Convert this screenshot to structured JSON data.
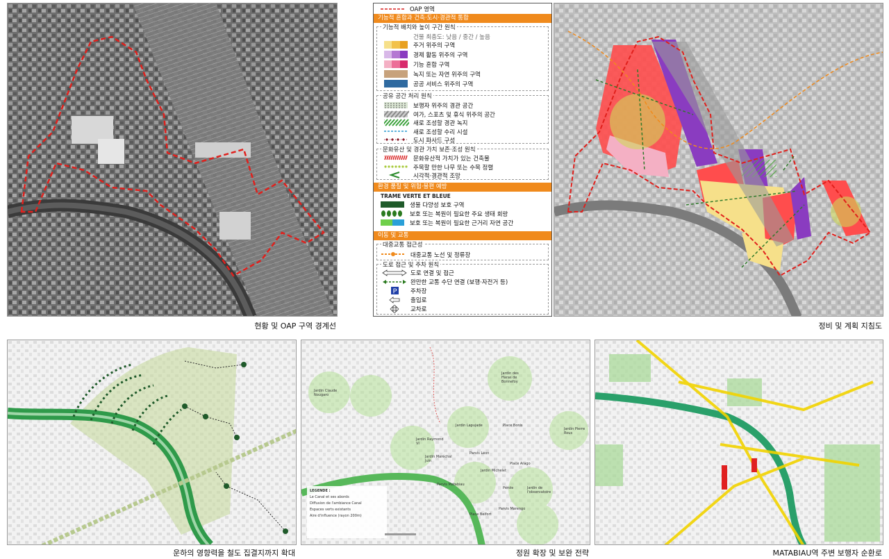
{
  "captions": {
    "top_left": "현황 및 OAP 구역 경계선",
    "top_right": "정비 및 계획 지침도",
    "bottom_left": "운하의 영향력을 철도 집결지까지 확대",
    "bottom_middle": "정원 확장 및 보완 전략",
    "bottom_right": "MATABIAU역 주변 보행자 순환로"
  },
  "legend": {
    "oap_label": "OAP 영역",
    "section1_bar": "기능적 혼합과 건축·도시·경관적 통합",
    "section1a_title": "기능적 배치와 높이 구간 원칙",
    "height_note": "건물 최층도: 낮음 / 중간 / 높음",
    "functions": [
      {
        "label": "주거 위주의 구역",
        "colors": [
          "#f6e08a",
          "#f2c24a",
          "#e8a020"
        ]
      },
      {
        "label": "경제 활동 위주의 구역",
        "colors": [
          "#d8b8e8",
          "#b478d2",
          "#8a3cc0"
        ]
      },
      {
        "label": "기능 혼합 구역",
        "colors": [
          "#f4b0c4",
          "#ec6e98",
          "#d82a6c"
        ]
      },
      {
        "label": "녹지 또는 자연 위주의 구역",
        "colors": [
          "#c7a27c",
          "#c7a27c",
          "#c7a27c"
        ]
      },
      {
        "label": "공공 서비스 위주의 구역",
        "colors": [
          "#2f6aa0",
          "#2f6aa0",
          "#2f6aa0"
        ]
      }
    ],
    "section1b_title": "공유 공간 처리 원칙",
    "shared": [
      {
        "label": "보행자 위주의 경관 공간",
        "style": "dots"
      },
      {
        "label": "여가, 스포츠 및 휴식 위주의 공간",
        "style": "hatch-grey"
      },
      {
        "label": "새로 조성할 경관 녹지",
        "style": "hatch-green"
      },
      {
        "label": "새로 조성할 수리 시설",
        "style": "dash-blue"
      },
      {
        "label": "도시 파사드 구성",
        "style": "diamond-red"
      }
    ],
    "section1c_title": "문화유산 및 경관 가치 보존·조성 원칙",
    "heritage": [
      {
        "label": "문화유산적 가치가 있는 건축물",
        "style": "hatch-red"
      },
      {
        "label": "주목할 만한 나무 또는 수목 정렬",
        "style": "dots-green"
      },
      {
        "label": "시각적·경관적 조망",
        "style": "view"
      }
    ],
    "section2_bar": "환경 품질 및 위험·불편 예방",
    "trame_title": "TRAME VERTE ET BLEUE",
    "trame": [
      {
        "label": "생물 다양성 보호 구역",
        "style": "dark-green"
      },
      {
        "label": "보호 또는 복원이 필요한 주요 생태 회랑",
        "style": "ovals"
      },
      {
        "label": "보호 또는 복원이 필요한 근거리 자연 공간",
        "style": "green-blue"
      }
    ],
    "section3_bar": "이동 및 교통",
    "transit_title": "대중교통 접근성",
    "transit_label": "대중교통 노선 및 정류장",
    "road_title": "도로 접근 및 주차 원칙",
    "roads": [
      {
        "label": "도로 연결 및 접근",
        "icon": "double-arrow-icon"
      },
      {
        "label": "완만한 교통 수단 연결 (보행·자전거 등)",
        "icon": "green-dashed-arrow-icon"
      },
      {
        "label": "주차장",
        "icon": "parking-icon"
      },
      {
        "label": "출입로",
        "icon": "entrance-arrow-icon"
      },
      {
        "label": "교차로",
        "icon": "crossroad-icon"
      }
    ]
  },
  "map_labels": {
    "gardens": [
      "Jardin Claude Nougaro",
      "Jardin des Haras de Bonnefoy",
      "Jardin Lapujade",
      "Place Bonis",
      "Jardin Pierre Rous",
      "Jardin Raymond VI",
      "Jardin Maréchal Juin",
      "Jardin Michelet",
      "Place Arago",
      "Jardin de l'observatoire",
      "Parvis Matabiau",
      "Parvis Léon",
      "Parvis Marengo",
      "Place Belfort",
      "Pérole"
    ],
    "legend_box_title": "LEGENDE :",
    "legend_box_items": [
      "Le Canal et ses abords",
      "Diffusion de l'ambiance Canal",
      "Espaces verts existants",
      "Aire d'influence (rayon 200m)"
    ]
  },
  "colors": {
    "accent_orange": "#f08a1c",
    "oap_red": "#d81f1f",
    "canal_green": "#3faa4a",
    "purple_zone": "#8a3cc0",
    "red_zone": "#ff4d4d",
    "pink_zone": "#f4b0c4",
    "yellow_zone": "#f6e08a"
  }
}
